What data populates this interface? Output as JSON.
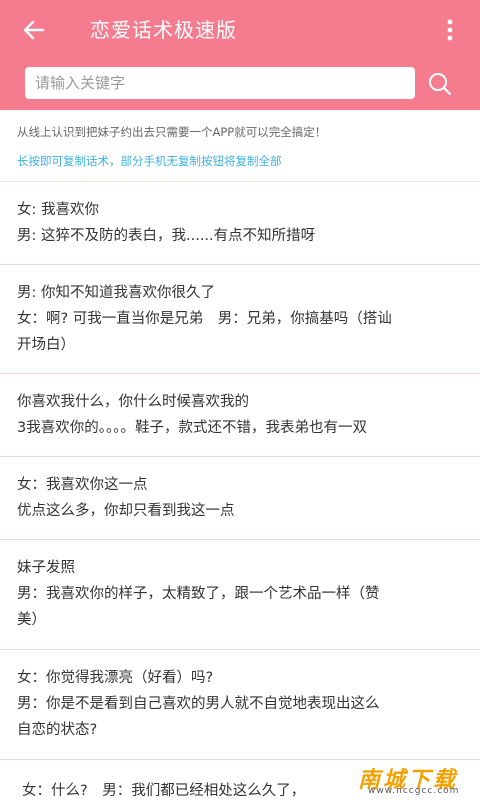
{
  "header": {
    "title": "恋爱话术极速版",
    "back_icon": "arrow-left-icon",
    "menu_icon": "more-vertical-icon",
    "background_color": "#f57c8e"
  },
  "search": {
    "placeholder": "请输入关键字",
    "value": "",
    "icon": "search-icon"
  },
  "intro": {
    "line1": "从线上认识到把妹子约出去只需要一个APP就可以完全搞定！",
    "line2": "长按即可复制话术，部分手机无复制按钮将复制全部",
    "line2_color": "#3bb1e0"
  },
  "items": [
    {
      "lines": [
        "女: 我喜欢你",
        "男: 这猝不及防的表白，我......有点不知所措呀"
      ]
    },
    {
      "lines": [
        "男: 你知不知道我喜欢你很久了",
        "女：啊? 可我一直当你是兄弟　男：兄弟，你搞基吗（搭讪",
        "开场白）"
      ]
    },
    {
      "lines": [
        "你喜欢我什么，你什么时候喜欢我的",
        "3我喜欢你的。。。。鞋子，款式还不错，我表弟也有一双"
      ]
    },
    {
      "lines": [
        "女：我喜欢你这一点",
        "优点这么多，你却只看到我这一点"
      ]
    },
    {
      "lines": [
        "妹子发照",
        "男：我喜欢你的样子，太精致了，跟一个艺术品一样（赞",
        "美）"
      ]
    },
    {
      "lines": [
        "女：你觉得我漂亮（好看）吗?",
        "男：你是不是看到自己喜欢的男人就不自觉地表现出这么",
        "自恋的状态?"
      ]
    },
    {
      "lines": [
        "女：什么?　男：我们都已经相处这么久了，"
      ]
    }
  ],
  "watermark": {
    "main": "南城下载",
    "sub": "www.nccgcc.com"
  }
}
